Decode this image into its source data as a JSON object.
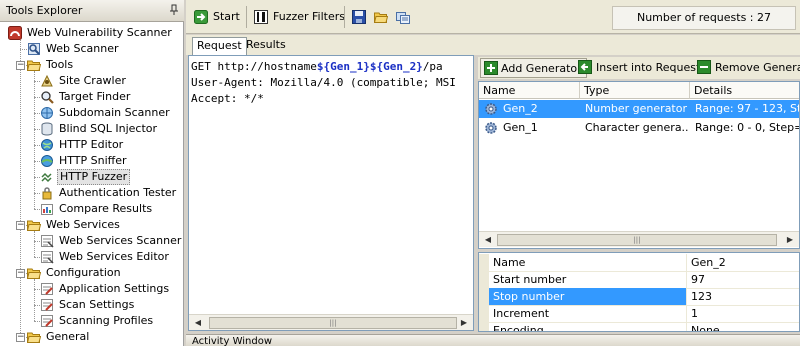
{
  "explorer": {
    "title": "Tools Explorer",
    "items": [
      {
        "label": "Web Vulnerability Scanner",
        "icon": "wvs-logo-icon",
        "level": 0,
        "expanded": true
      },
      {
        "label": "Web Scanner",
        "icon": "web-scanner-icon",
        "level": 1
      },
      {
        "label": "Tools",
        "icon": "folder-open-icon",
        "level": 1,
        "expanded": true
      },
      {
        "label": "Site Crawler",
        "icon": "site-crawler-icon",
        "level": 2
      },
      {
        "label": "Target Finder",
        "icon": "target-finder-icon",
        "level": 2
      },
      {
        "label": "Subdomain Scanner",
        "icon": "subdomain-scanner-icon",
        "level": 2
      },
      {
        "label": "Blind SQL Injector",
        "icon": "blind-sql-icon",
        "level": 2
      },
      {
        "label": "HTTP Editor",
        "icon": "http-editor-icon",
        "level": 2
      },
      {
        "label": "HTTP Sniffer",
        "icon": "http-sniffer-icon",
        "level": 2
      },
      {
        "label": "HTTP Fuzzer",
        "icon": "http-fuzzer-icon",
        "level": 2,
        "selected": true
      },
      {
        "label": "Authentication Tester",
        "icon": "auth-tester-icon",
        "level": 2
      },
      {
        "label": "Compare Results",
        "icon": "compare-results-icon",
        "level": 2
      },
      {
        "label": "Web Services",
        "icon": "folder-open-icon",
        "level": 1,
        "expanded": true
      },
      {
        "label": "Web Services Scanner",
        "icon": "ws-scanner-icon",
        "level": 2
      },
      {
        "label": "Web Services Editor",
        "icon": "ws-editor-icon",
        "level": 2
      },
      {
        "label": "Configuration",
        "icon": "folder-open-icon",
        "level": 1,
        "expanded": true
      },
      {
        "label": "Application Settings",
        "icon": "app-settings-icon",
        "level": 2
      },
      {
        "label": "Scan Settings",
        "icon": "scan-settings-icon",
        "level": 2
      },
      {
        "label": "Scanning Profiles",
        "icon": "scanning-profiles-icon",
        "level": 2
      },
      {
        "label": "General",
        "icon": "folder-open-icon",
        "level": 1,
        "expanded": true
      }
    ]
  },
  "toolbar": {
    "start_label": "Start",
    "fuzzer_filters_label": "Fuzzer Filters",
    "request_count": "Number of requests : 27"
  },
  "tabs": [
    {
      "label": "Request",
      "active": true
    },
    {
      "label": "Results",
      "active": false
    }
  ],
  "request": {
    "lines": [
      [
        {
          "t": "GET http://hostname"
        },
        {
          "t": "${Gen_1}",
          "var": true
        },
        {
          "t": "${Gen_2}",
          "var": true
        },
        {
          "t": "/pa"
        }
      ],
      [
        {
          "t": "User-Agent: Mozilla/4.0 (compatible; MSI"
        }
      ],
      [
        {
          "t": "Accept: */*"
        }
      ]
    ]
  },
  "generator_toolbar": {
    "add_label": "Add Generator",
    "insert_label": "Insert into Request",
    "remove_label": "Remove Generator"
  },
  "generators": {
    "columns": [
      "Name",
      "Type",
      "Details"
    ],
    "rows": [
      {
        "name": "Gen_2",
        "type": "Number generator",
        "details": "Range: 97 - 123, Ste",
        "selected": true
      },
      {
        "name": "Gen_1",
        "type": "Character genera...",
        "details": "Range: 0 - 0, Step=",
        "selected": false
      }
    ]
  },
  "properties": [
    {
      "name": "Name",
      "value": "Gen_2"
    },
    {
      "name": "Start number",
      "value": "97"
    },
    {
      "name": "Stop number",
      "value": "123",
      "selected": true
    },
    {
      "name": "Increment",
      "value": "1"
    },
    {
      "name": "Encoding",
      "value": "None"
    }
  ],
  "activity": {
    "title": "Activity Window"
  },
  "colors": {
    "selection": "#3399ff",
    "variable": "#1a2fc4",
    "chrome": "#ece9d8"
  }
}
